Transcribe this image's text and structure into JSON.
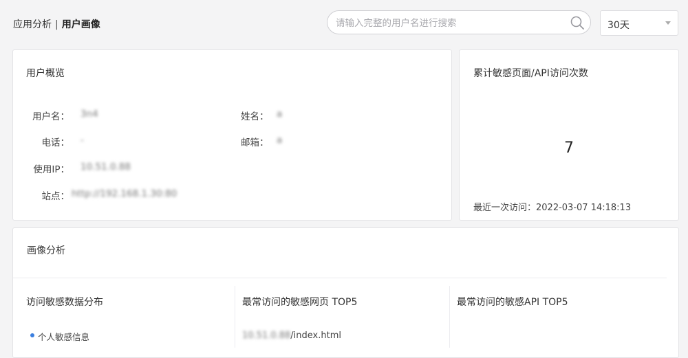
{
  "breadcrumb": {
    "parent": "应用分析",
    "separator": "|",
    "current": "用户画像"
  },
  "search": {
    "placeholder": "请输入完整的用户名进行搜索",
    "icon": "search-icon"
  },
  "time_range": {
    "selected": "30天",
    "icon": "caret-down-icon"
  },
  "user_overview": {
    "title": "用户概览",
    "fields": {
      "username": {
        "label": "用户名：",
        "value": "3n4"
      },
      "name": {
        "label": "姓名：",
        "value": "a"
      },
      "phone": {
        "label": "电话：",
        "value": "-"
      },
      "email": {
        "label": "邮箱：",
        "value": "a"
      },
      "ip": {
        "label": "使用IP：",
        "value": "10.51.0.88"
      },
      "site": {
        "label": "站点：",
        "value": "http://192.168.1.30:80"
      }
    }
  },
  "sensitive_count": {
    "title": "累计敏感页面/API访问次数",
    "value": "7",
    "last_visit_label": "最近一次访问：",
    "last_visit_time": "2022-03-07 14:18:13"
  },
  "profile_analysis": {
    "title": "画像分析",
    "distribution": {
      "title": "访问敏感数据分布",
      "items": [
        {
          "label": "个人敏感信息",
          "color": "#3b7fe0"
        }
      ]
    },
    "top_pages": {
      "title": "最常访问的敏感网页 TOP5",
      "items": [
        {
          "host": "10.51.0.88",
          "path": "/index.html"
        }
      ]
    },
    "top_apis": {
      "title": "最常访问的敏感API TOP5"
    }
  }
}
